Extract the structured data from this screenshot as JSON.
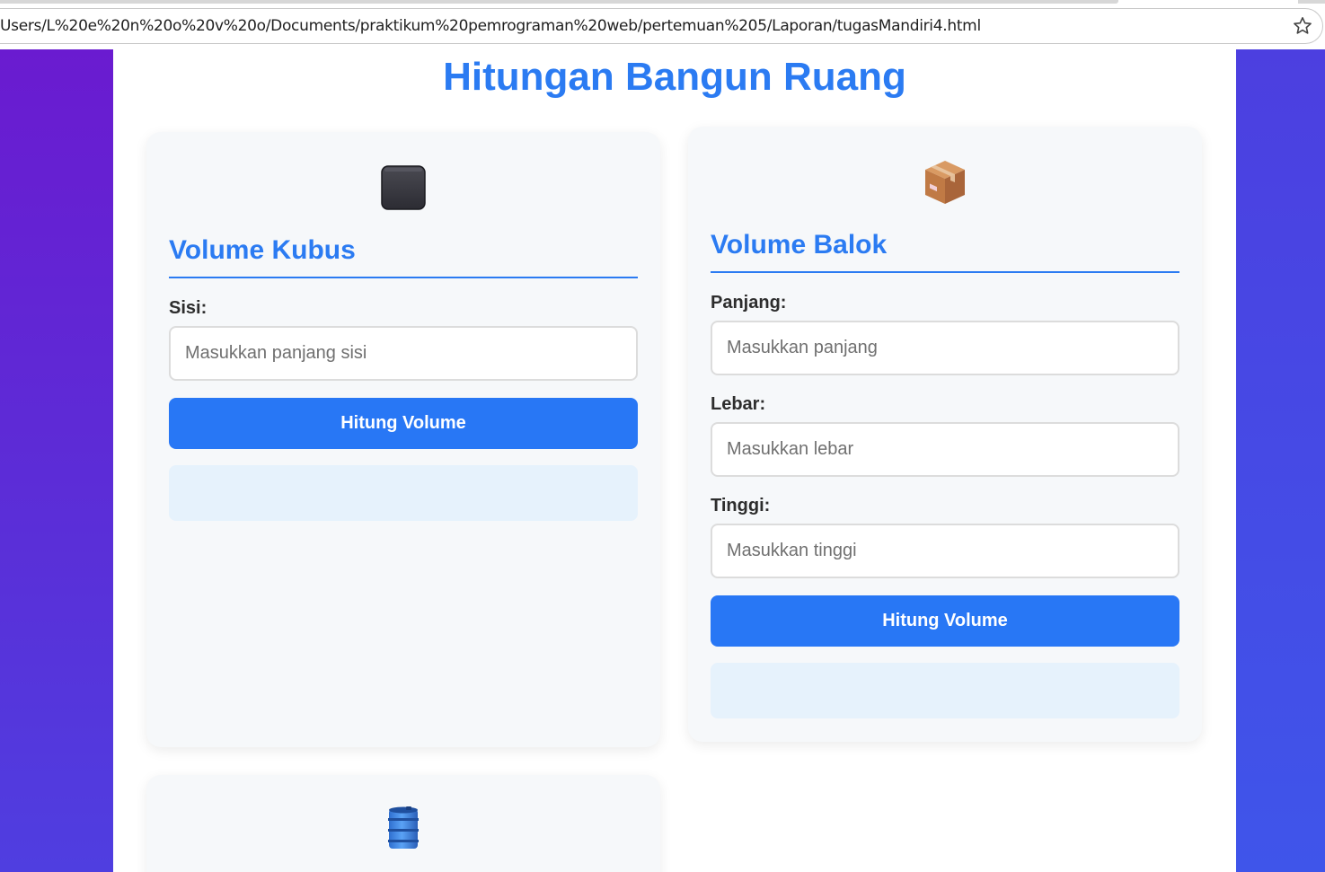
{
  "browser": {
    "url": "Users/L%20e%20n%20o%20v%20o/Documents/praktikum%20pemrograman%20web/pertemuan%205/Laporan/tugasMandiri4.html"
  },
  "page": {
    "title": "Hitungan Bangun Ruang"
  },
  "colors": {
    "accent": "#2b7bf2",
    "button": "#2877f5",
    "result_bg": "#e6f2fc",
    "card_bg": "#f6f8fa"
  },
  "kubus": {
    "icon": "black-cube-icon",
    "title": "Volume Kubus",
    "sisi_label": "Sisi:",
    "sisi_placeholder": "Masukkan panjang sisi",
    "button_label": "Hitung Volume",
    "result": ""
  },
  "balok": {
    "icon": "package-box-icon",
    "title": "Volume Balok",
    "panjang_label": "Panjang:",
    "panjang_placeholder": "Masukkan panjang",
    "lebar_label": "Lebar:",
    "lebar_placeholder": "Masukkan lebar",
    "tinggi_label": "Tinggi:",
    "tinggi_placeholder": "Masukkan tinggi",
    "button_label": "Hitung Volume",
    "result": ""
  },
  "tabung": {
    "icon": "barrel-cylinder-icon"
  }
}
